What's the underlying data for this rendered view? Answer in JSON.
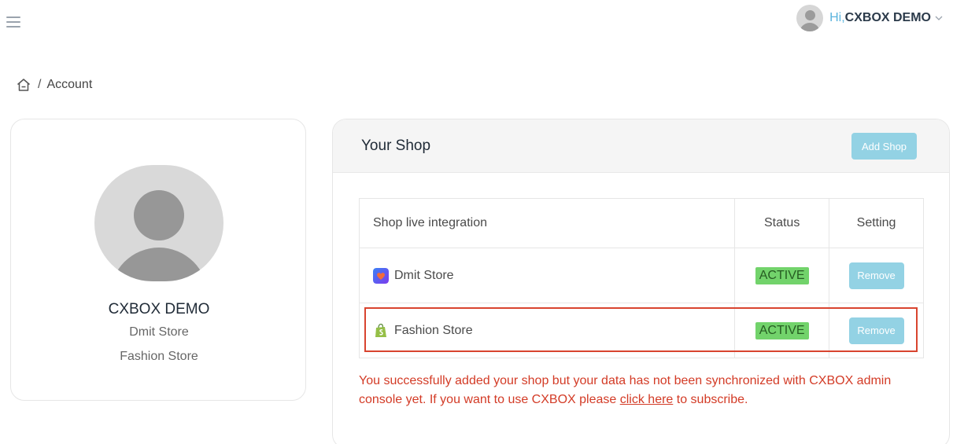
{
  "header": {
    "greeting": "Hi,",
    "user_name": "CXBOX DEMO"
  },
  "breadcrumb": {
    "current": "Account",
    "separator": "/"
  },
  "profile": {
    "name": "CXBOX DEMO",
    "stores": [
      "Dmit Store",
      "Fashion Store"
    ]
  },
  "shop_panel": {
    "title": "Your Shop",
    "add_label": "Add Shop",
    "columns": [
      "Shop live integration",
      "Status",
      "Setting"
    ],
    "rows": [
      {
        "name": "Dmit Store",
        "logo": "dmit-store-logo",
        "status": "ACTIVE",
        "action": "Remove"
      },
      {
        "name": "Fashion Store",
        "logo": "shopify-logo",
        "status": "ACTIVE",
        "action": "Remove"
      }
    ],
    "notice_before": "You successfully added your shop but your data has not been synchronized with CXBOX admin console yet. If you want to use CXBOX please ",
    "notice_link": "click here",
    "notice_after": " to subscribe."
  },
  "colors": {
    "accent_button": "#93d2e4",
    "active_badge": "#72d36b",
    "alert_text": "#d33b26",
    "greeting_text": "#5bb4dd"
  }
}
